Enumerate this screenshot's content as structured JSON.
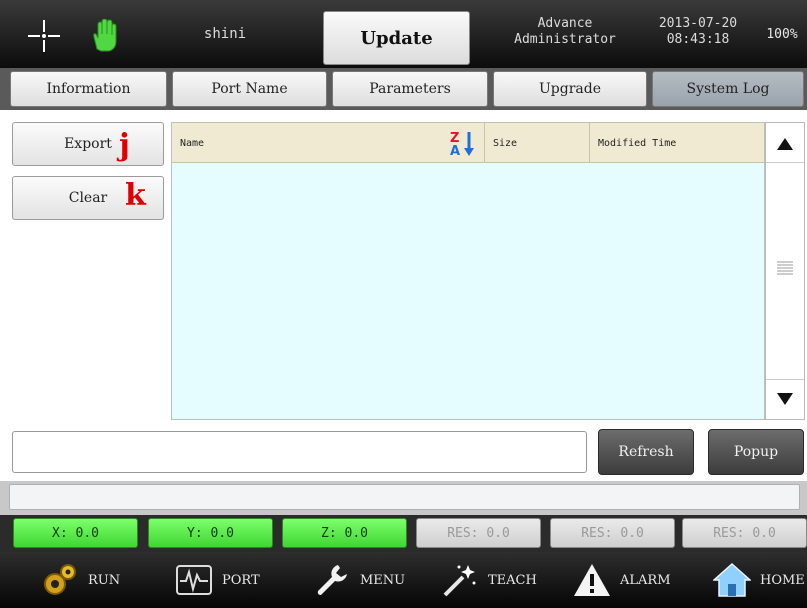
{
  "header": {
    "user": "shini",
    "title": "Update",
    "role_line1": "Advance",
    "role_line2": "Administrator",
    "date": "2013-07-20",
    "time": "08:43:18",
    "percent": "100%",
    "icons": [
      "crosshair-icon",
      "hand-icon"
    ]
  },
  "tabs": [
    {
      "label": "Information",
      "active": false
    },
    {
      "label": "Port Name",
      "active": false
    },
    {
      "label": "Parameters",
      "active": false
    },
    {
      "label": "Upgrade",
      "active": false
    },
    {
      "label": "System Log",
      "active": true
    }
  ],
  "side_buttons": {
    "export": {
      "label": "Export",
      "hotkey": "j"
    },
    "clear": {
      "label": "Clear",
      "hotkey": "k"
    }
  },
  "table": {
    "columns": [
      "Name",
      "Size",
      "Modified Time"
    ],
    "rows": [],
    "sort_icon": "sort-z-a-icon"
  },
  "scrollbar": {
    "up_icon": "triangle-up-icon",
    "down_icon": "triangle-down-icon",
    "thumb_icon": "grip-lines-icon"
  },
  "path_field": {
    "value": "",
    "placeholder": ""
  },
  "actions": {
    "refresh": "Refresh",
    "popup": "Popup"
  },
  "message": "",
  "coords": [
    {
      "label": "X: 0.0",
      "active": true
    },
    {
      "label": "Y: 0.0",
      "active": true
    },
    {
      "label": "Z: 0.0",
      "active": true
    },
    {
      "label": "RES: 0.0",
      "active": false
    },
    {
      "label": "RES: 0.0",
      "active": false
    },
    {
      "label": "RES: 0.0",
      "active": false
    }
  ],
  "nav": [
    {
      "label": "RUN",
      "icon": "gears-icon"
    },
    {
      "label": "PORT",
      "icon": "waveform-icon"
    },
    {
      "label": "MENU",
      "icon": "wrench-icon"
    },
    {
      "label": "TEACH",
      "icon": "magic-wand-icon"
    },
    {
      "label": "ALARM",
      "icon": "warning-icon"
    },
    {
      "label": "HOME",
      "icon": "house-icon"
    }
  ],
  "colors": {
    "accent_green": "#3fd632",
    "table_bg": "#e6fdff",
    "table_header": "#f0ead2",
    "hotkey_red": "#e00000"
  }
}
